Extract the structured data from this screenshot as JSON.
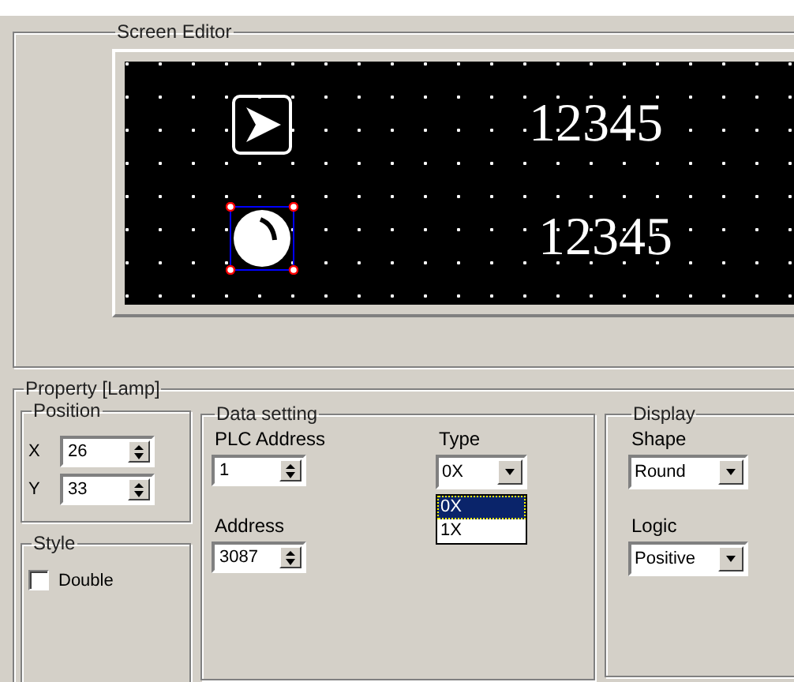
{
  "screen_editor": {
    "title": "Screen Editor",
    "canvas_rows": [
      {
        "kind": "button",
        "value": "12345",
        "selected": false
      },
      {
        "kind": "lamp",
        "value": "12345",
        "selected": true
      }
    ]
  },
  "property": {
    "title": "Property  [Lamp]",
    "position": {
      "title": "Position",
      "fields": [
        {
          "label": "X",
          "value": "26"
        },
        {
          "label": "Y",
          "value": "33"
        }
      ]
    },
    "style": {
      "title": "Style",
      "checkbox": {
        "label": "Double",
        "checked": false
      }
    },
    "data_setting": {
      "title": "Data setting",
      "plc_address": {
        "label": "PLC Address",
        "value": "1"
      },
      "address": {
        "label": "Address",
        "value": "3087"
      },
      "type": {
        "label": "Type",
        "value": "0X",
        "options": [
          {
            "label": "0X",
            "selected": true
          },
          {
            "label": "1X",
            "selected": false
          }
        ]
      }
    },
    "display": {
      "title": "Display",
      "shape": {
        "label": "Shape",
        "value": "Round"
      },
      "logic": {
        "label": "Logic",
        "value": "Positive"
      }
    }
  }
}
